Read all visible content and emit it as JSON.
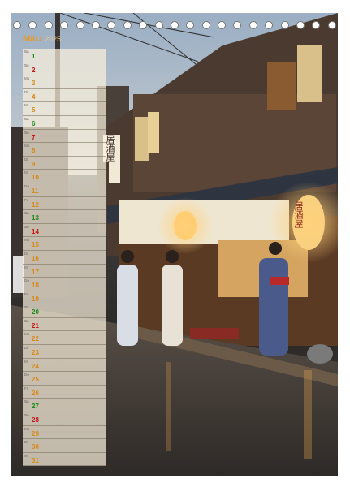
{
  "calendar": {
    "month": "März",
    "year": "2025",
    "days": [
      {
        "wd": "Sa",
        "d": "1",
        "t": "sat"
      },
      {
        "wd": "So",
        "d": "2",
        "t": "sun"
      },
      {
        "wd": "Mo",
        "d": "3",
        "t": ""
      },
      {
        "wd": "Di",
        "d": "4",
        "t": ""
      },
      {
        "wd": "Mi",
        "d": "5",
        "t": ""
      },
      {
        "wd": "Sa",
        "d": "6",
        "t": "sat"
      },
      {
        "wd": "So",
        "d": "7",
        "t": "sun"
      },
      {
        "wd": "Mo",
        "d": "8",
        "t": ""
      },
      {
        "wd": "Di",
        "d": "9",
        "t": ""
      },
      {
        "wd": "Mi",
        "d": "10",
        "t": ""
      },
      {
        "wd": "Do",
        "d": "11",
        "t": ""
      },
      {
        "wd": "Fr",
        "d": "12",
        "t": ""
      },
      {
        "wd": "Sa",
        "d": "13",
        "t": "sat"
      },
      {
        "wd": "So",
        "d": "14",
        "t": "sun"
      },
      {
        "wd": "Mo",
        "d": "15",
        "t": ""
      },
      {
        "wd": "Di",
        "d": "16",
        "t": ""
      },
      {
        "wd": "Mi",
        "d": "17",
        "t": ""
      },
      {
        "wd": "Do",
        "d": "18",
        "t": ""
      },
      {
        "wd": "Fr",
        "d": "19",
        "t": ""
      },
      {
        "wd": "Sa",
        "d": "20",
        "t": "sat"
      },
      {
        "wd": "So",
        "d": "21",
        "t": "sun"
      },
      {
        "wd": "Mo",
        "d": "22",
        "t": ""
      },
      {
        "wd": "Di",
        "d": "23",
        "t": ""
      },
      {
        "wd": "Mi",
        "d": "24",
        "t": ""
      },
      {
        "wd": "Do",
        "d": "25",
        "t": ""
      },
      {
        "wd": "Fr",
        "d": "26",
        "t": ""
      },
      {
        "wd": "Sa",
        "d": "27",
        "t": "sat"
      },
      {
        "wd": "So",
        "d": "28",
        "t": "sun"
      },
      {
        "wd": "Mo",
        "d": "29",
        "t": ""
      },
      {
        "wd": "Di",
        "d": "30",
        "t": ""
      },
      {
        "wd": "Mi",
        "d": "31",
        "t": ""
      }
    ]
  },
  "signs": {
    "left_sign": "居酒屋",
    "lantern": "居酒屋"
  },
  "colors": {
    "month": "#e59a2a",
    "weekday": "#d48a1c",
    "saturday": "#1a8a1a",
    "sunday": "#c4151c",
    "row_bg": "#faf0dc"
  }
}
